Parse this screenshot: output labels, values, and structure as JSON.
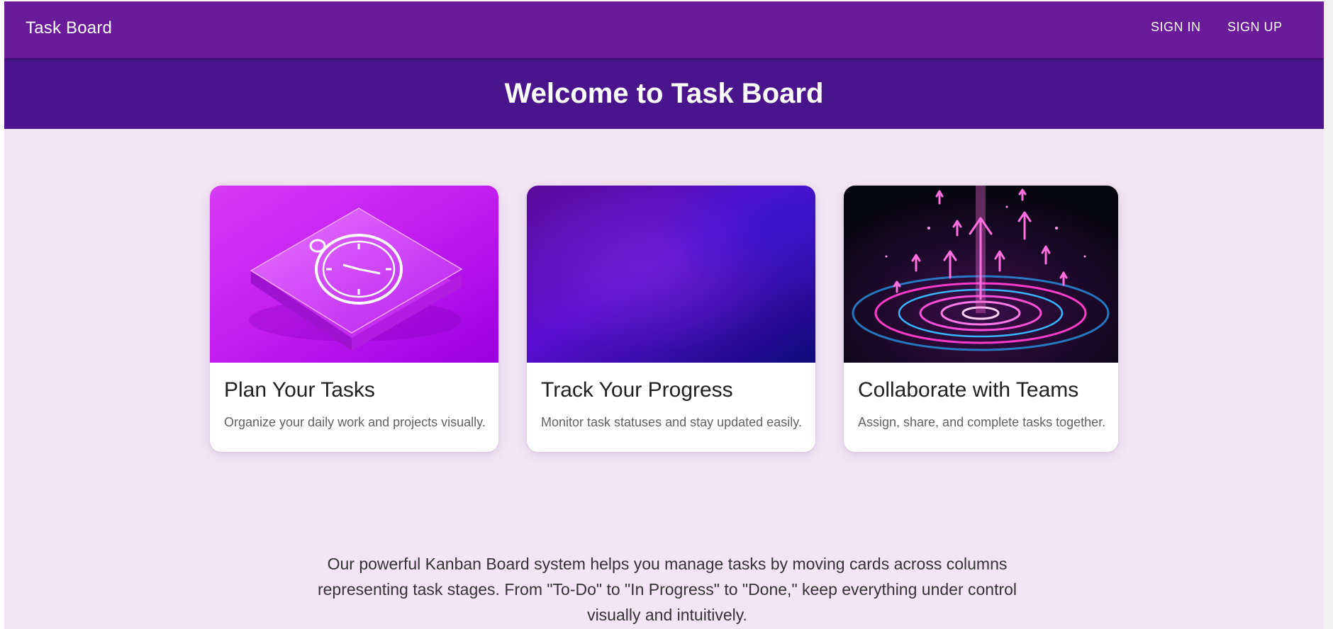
{
  "header": {
    "brand": "Task Board",
    "sign_in": "SIGN IN",
    "sign_up": "SIGN UP"
  },
  "hero": {
    "title": "Welcome to Task Board"
  },
  "cards": [
    {
      "title": "Plan Your Tasks",
      "description": "Organize your daily work and projects visually.",
      "image_icon": "stopwatch-icon"
    },
    {
      "title": "Track Your Progress",
      "description": "Monitor task statuses and stay updated easily.",
      "image_icon": "purple-gradient-image"
    },
    {
      "title": "Collaborate with Teams",
      "description": "Assign, share, and complete tasks together.",
      "image_icon": "neon-arrows-icon"
    }
  ],
  "intro": {
    "text": "Our powerful Kanban Board system helps you manage tasks by moving cards across columns representing task stages. From \"To-Do\" to \"In Progress\" to \"Done,\" keep everything under control visually and intuitively."
  },
  "colors": {
    "appbar": "#6a1b9a",
    "hero": "#4a148c",
    "background": "#f3e5f5"
  }
}
